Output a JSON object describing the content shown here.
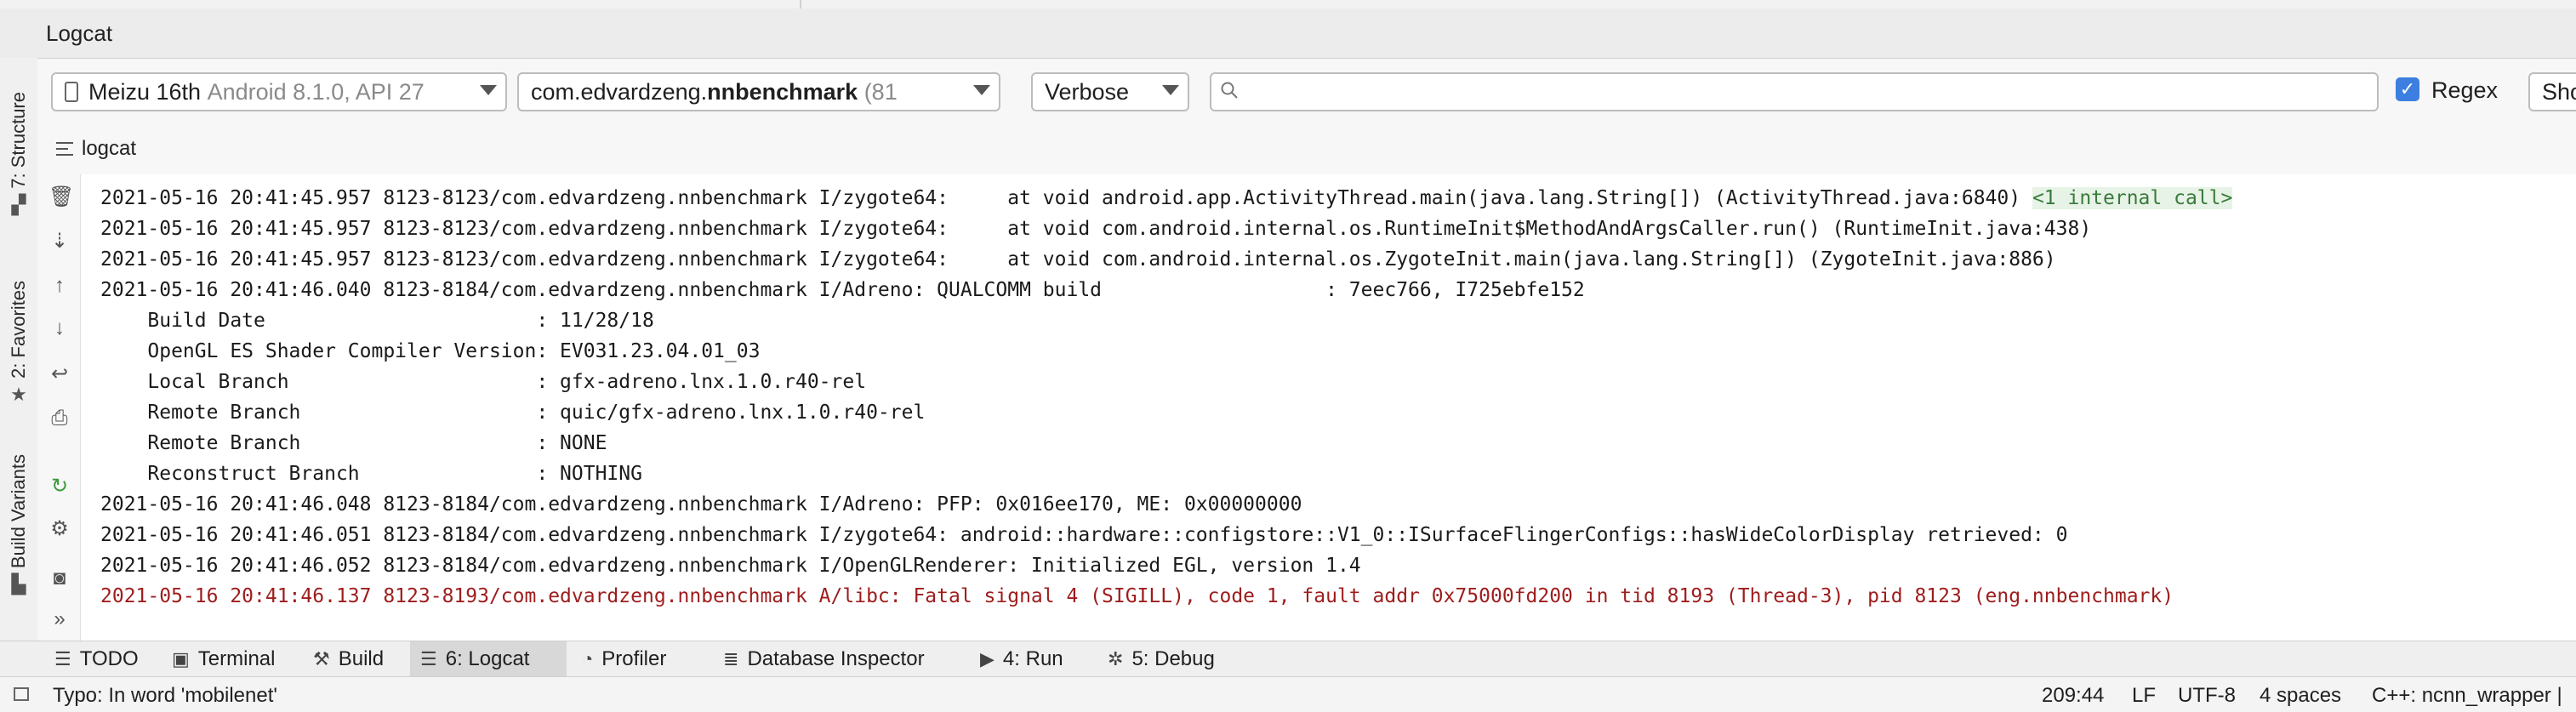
{
  "window": {
    "title": "Logcat"
  },
  "sidebar": {
    "tabs": [
      {
        "label": "7: Structure"
      },
      {
        "label": "2: Favorites"
      },
      {
        "label": "Build Variants"
      }
    ]
  },
  "toolbar": {
    "device": {
      "name": "Meizu 16th",
      "detail": "Android 8.1.0, API 27"
    },
    "process": {
      "prefix": "com.edvardzeng.",
      "bold": "nnbenchmark",
      "detail": "(81"
    },
    "level": "Verbose",
    "search": {
      "value": "",
      "placeholder": ""
    },
    "regex": {
      "label": "Regex",
      "checked": true
    },
    "show_label": "Show"
  },
  "subtab": {
    "label": "logcat"
  },
  "log": {
    "lines": [
      {
        "text": "2021-05-16 20:41:45.957 8123-8123/com.edvardzeng.nnbenchmark I/zygote64:     at void android.app.ActivityThread.main(java.lang.String[]) (ActivityThread.java:6840) ",
        "badge": "<1 internal call>",
        "level": "info"
      },
      {
        "text": "2021-05-16 20:41:45.957 8123-8123/com.edvardzeng.nnbenchmark I/zygote64:     at void com.android.internal.os.RuntimeInit$MethodAndArgsCaller.run() (RuntimeInit.java:438)",
        "level": "info"
      },
      {
        "text": "2021-05-16 20:41:45.957 8123-8123/com.edvardzeng.nnbenchmark I/zygote64:     at void com.android.internal.os.ZygoteInit.main(java.lang.String[]) (ZygoteInit.java:886)",
        "level": "info"
      },
      {
        "text": "2021-05-16 20:41:46.040 8123-8184/com.edvardzeng.nnbenchmark I/Adreno: QUALCOMM build                   : 7eec766, I725ebfe152",
        "level": "info"
      },
      {
        "text": "    Build Date                       : 11/28/18",
        "level": "info"
      },
      {
        "text": "    OpenGL ES Shader Compiler Version: EV031.23.04.01_03",
        "level": "info"
      },
      {
        "text": "    Local Branch                     : gfx-adreno.lnx.1.0.r40-rel",
        "level": "info"
      },
      {
        "text": "    Remote Branch                    : quic/gfx-adreno.lnx.1.0.r40-rel",
        "level": "info"
      },
      {
        "text": "    Remote Branch                    : NONE",
        "level": "info"
      },
      {
        "text": "    Reconstruct Branch               : NOTHING",
        "level": "info"
      },
      {
        "text": "2021-05-16 20:41:46.048 8123-8184/com.edvardzeng.nnbenchmark I/Adreno: PFP: 0x016ee170, ME: 0x00000000",
        "level": "info"
      },
      {
        "text": "2021-05-16 20:41:46.051 8123-8184/com.edvardzeng.nnbenchmark I/zygote64: android::hardware::configstore::V1_0::ISurfaceFlingerConfigs::hasWideColorDisplay retrieved: 0",
        "level": "info"
      },
      {
        "text": "2021-05-16 20:41:46.052 8123-8184/com.edvardzeng.nnbenchmark I/OpenGLRenderer: Initialized EGL, version 1.4",
        "level": "info"
      },
      {
        "text": "2021-05-16 20:41:46.137 8123-8193/com.edvardzeng.nnbenchmark A/libc: Fatal signal 4 (SIGILL), code 1, fault addr 0x75000fd200 in tid 8193 (Thread-3), pid 8123 (eng.nnbenchmark)",
        "level": "fatal"
      }
    ]
  },
  "bottom_tabs": [
    {
      "label": "TODO",
      "icon": "list-icon"
    },
    {
      "label": "Terminal",
      "icon": "terminal-icon"
    },
    {
      "label": "Build",
      "icon": "hammer-icon"
    },
    {
      "label": "6: Logcat",
      "icon": "logcat-icon",
      "active": true
    },
    {
      "label": "Profiler",
      "icon": "gauge-icon"
    },
    {
      "label": "Database Inspector",
      "icon": "database-icon"
    },
    {
      "label": "4: Run",
      "icon": "play-icon"
    },
    {
      "label": "5: Debug",
      "icon": "bug-icon"
    }
  ],
  "status": {
    "message": "Typo: In word 'mobilenet'",
    "position": "209:44",
    "line_ending": "LF",
    "encoding": "UTF-8",
    "indent": "4 spaces",
    "context": "C++: ncnn_wrapper |"
  },
  "colors": {
    "fatal": "#9e1c1c",
    "checkbox": "#3d7fe0",
    "badge_bg": "#e6f3e6"
  }
}
